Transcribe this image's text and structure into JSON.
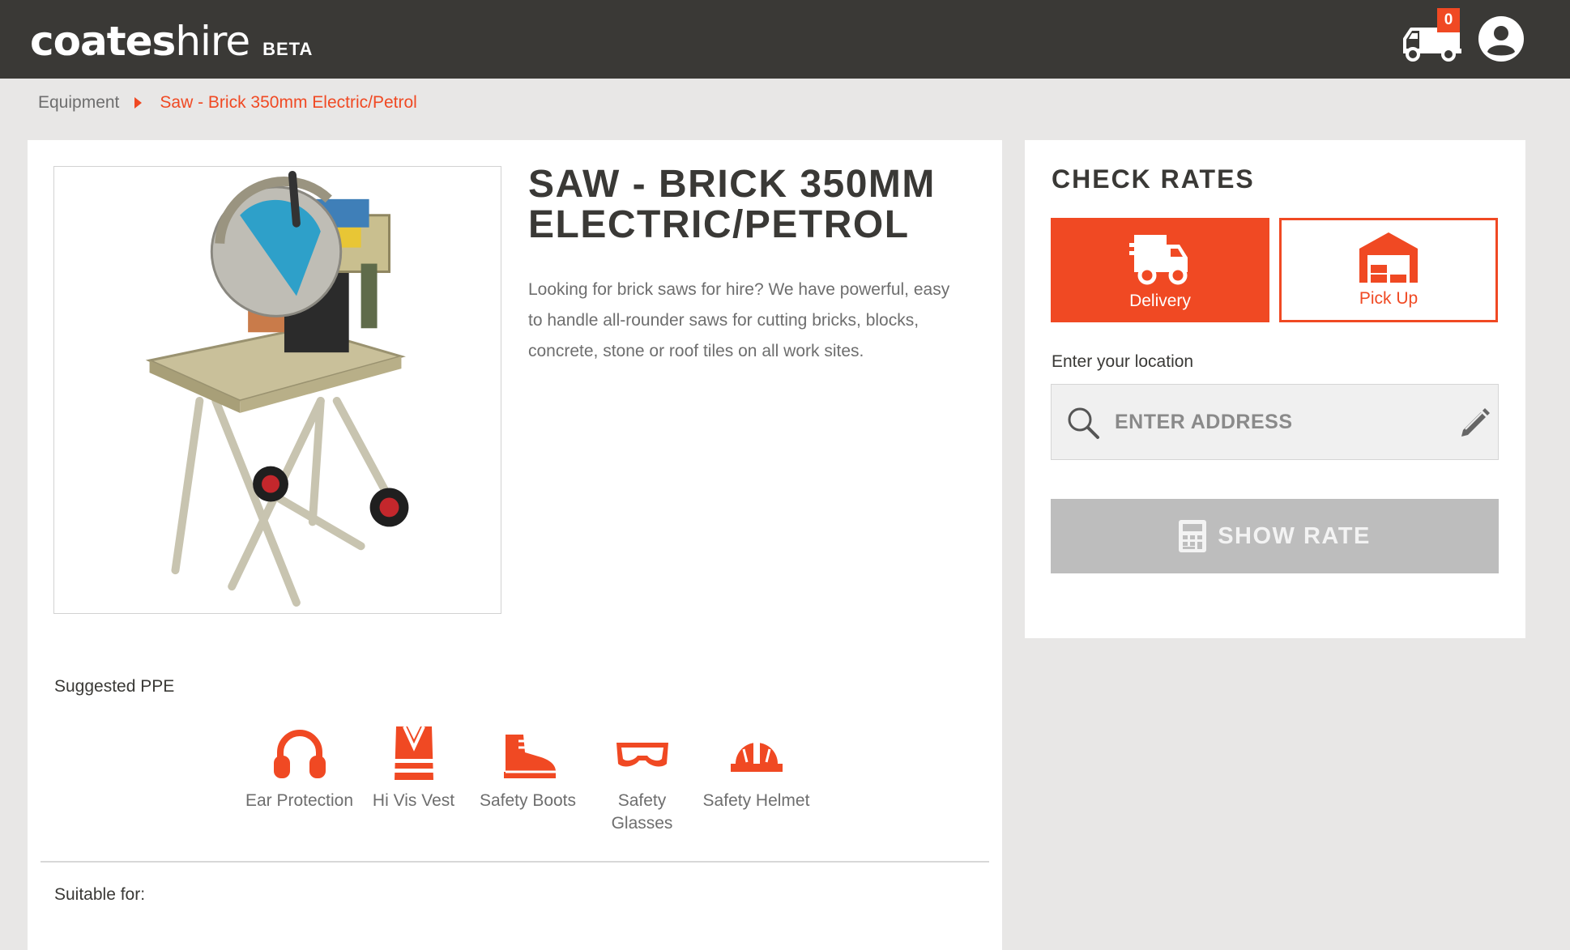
{
  "header": {
    "logo_main": "coates",
    "logo_hire": "hire",
    "logo_badge": "BETA",
    "cart_count": "0",
    "icons": [
      "truck-icon",
      "user-icon"
    ]
  },
  "breadcrumb": {
    "root": "Equipment",
    "current": "Saw - Brick 350mm Electric/Petrol"
  },
  "product": {
    "title": "SAW - BRICK 350MM ELECTRIC/PETROL",
    "description": "Looking for brick saws for hire? We have powerful, easy to handle all-rounder saws for cutting bricks, blocks, concrete, stone or roof tiles on all work sites."
  },
  "ppe": {
    "heading": "Suggested PPE",
    "items": [
      {
        "label": "Ear Protection",
        "icon": "ear-protection-icon"
      },
      {
        "label": "Hi Vis Vest",
        "icon": "hi-vis-vest-icon"
      },
      {
        "label": "Safety Boots",
        "icon": "safety-boots-icon"
      },
      {
        "label": "Safety Glasses",
        "icon": "safety-glasses-icon"
      },
      {
        "label": "Safety Helmet",
        "icon": "safety-helmet-icon"
      }
    ]
  },
  "suitable": {
    "heading": "Suitable for:"
  },
  "rates": {
    "title": "CHECK RATES",
    "delivery_label": "Delivery",
    "pickup_label": "Pick Up",
    "location_label": "Enter your location",
    "address_placeholder": "ENTER ADDRESS",
    "address_value": "",
    "show_rate_label": "SHOW RATE"
  },
  "colors": {
    "accent": "#f04923",
    "header_bg": "#3a3936",
    "page_bg": "#e8e7e6",
    "disabled_button": "#bdbdbd"
  }
}
